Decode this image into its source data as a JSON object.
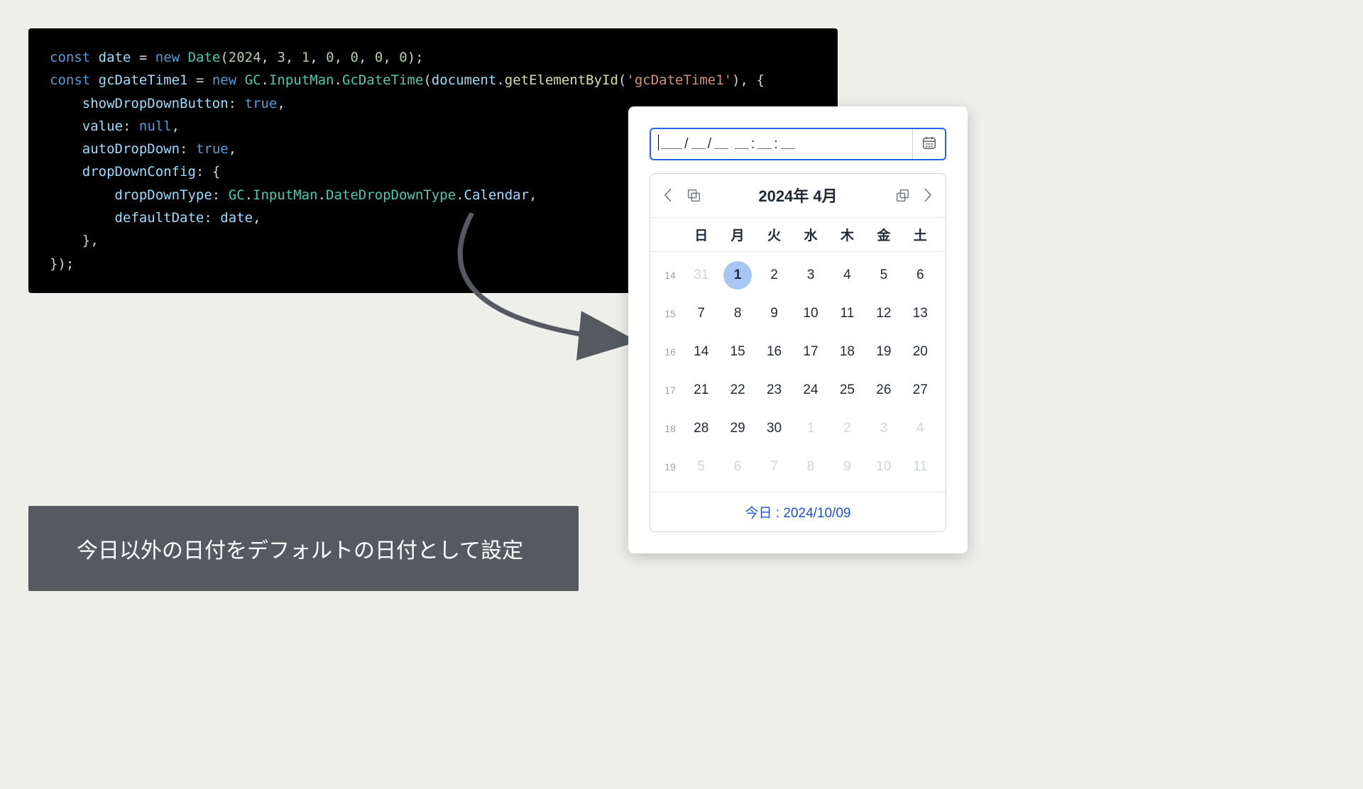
{
  "code": {
    "full_text": "const date = new Date(2024, 3, 1, 0, 0, 0, 0);\nconst gcDateTime1 = new GC.InputMan.GcDateTime(document.getElementById('gcDateTime1'), {\n    showDropDownButton: true,\n    value: null,\n    autoDropDown: true,\n    dropDownConfig: {\n        dropDownType: GC.InputMan.DateDropDownType.Calendar,\n        defaultDate: date,\n    },\n});"
  },
  "caption": "今日以外の日付をデフォルトの日付として設定",
  "input": {
    "mask_display": "____/__/__ __:__:__"
  },
  "calendar": {
    "title": "2024年 4月",
    "weekdays": [
      "日",
      "月",
      "火",
      "水",
      "木",
      "金",
      "土"
    ],
    "rows": [
      {
        "week": "14",
        "days": [
          {
            "d": "31",
            "outside": true
          },
          {
            "d": "1",
            "selected": true
          },
          {
            "d": "2"
          },
          {
            "d": "3"
          },
          {
            "d": "4"
          },
          {
            "d": "5"
          },
          {
            "d": "6"
          }
        ]
      },
      {
        "week": "15",
        "days": [
          {
            "d": "7"
          },
          {
            "d": "8"
          },
          {
            "d": "9"
          },
          {
            "d": "10"
          },
          {
            "d": "11"
          },
          {
            "d": "12"
          },
          {
            "d": "13"
          }
        ]
      },
      {
        "week": "16",
        "days": [
          {
            "d": "14"
          },
          {
            "d": "15"
          },
          {
            "d": "16"
          },
          {
            "d": "17"
          },
          {
            "d": "18"
          },
          {
            "d": "19"
          },
          {
            "d": "20"
          }
        ]
      },
      {
        "week": "17",
        "days": [
          {
            "d": "21"
          },
          {
            "d": "22"
          },
          {
            "d": "23"
          },
          {
            "d": "24"
          },
          {
            "d": "25"
          },
          {
            "d": "26"
          },
          {
            "d": "27"
          }
        ]
      },
      {
        "week": "18",
        "days": [
          {
            "d": "28"
          },
          {
            "d": "29"
          },
          {
            "d": "30"
          },
          {
            "d": "1",
            "outside": true
          },
          {
            "d": "2",
            "outside": true
          },
          {
            "d": "3",
            "outside": true
          },
          {
            "d": "4",
            "outside": true
          }
        ]
      },
      {
        "week": "19",
        "days": [
          {
            "d": "5",
            "outside": true
          },
          {
            "d": "6",
            "outside": true
          },
          {
            "d": "7",
            "outside": true
          },
          {
            "d": "8",
            "outside": true
          },
          {
            "d": "9",
            "outside": true
          },
          {
            "d": "10",
            "outside": true
          },
          {
            "d": "11",
            "outside": true
          }
        ]
      }
    ],
    "today_label": "今日 : 2024/10/09"
  }
}
